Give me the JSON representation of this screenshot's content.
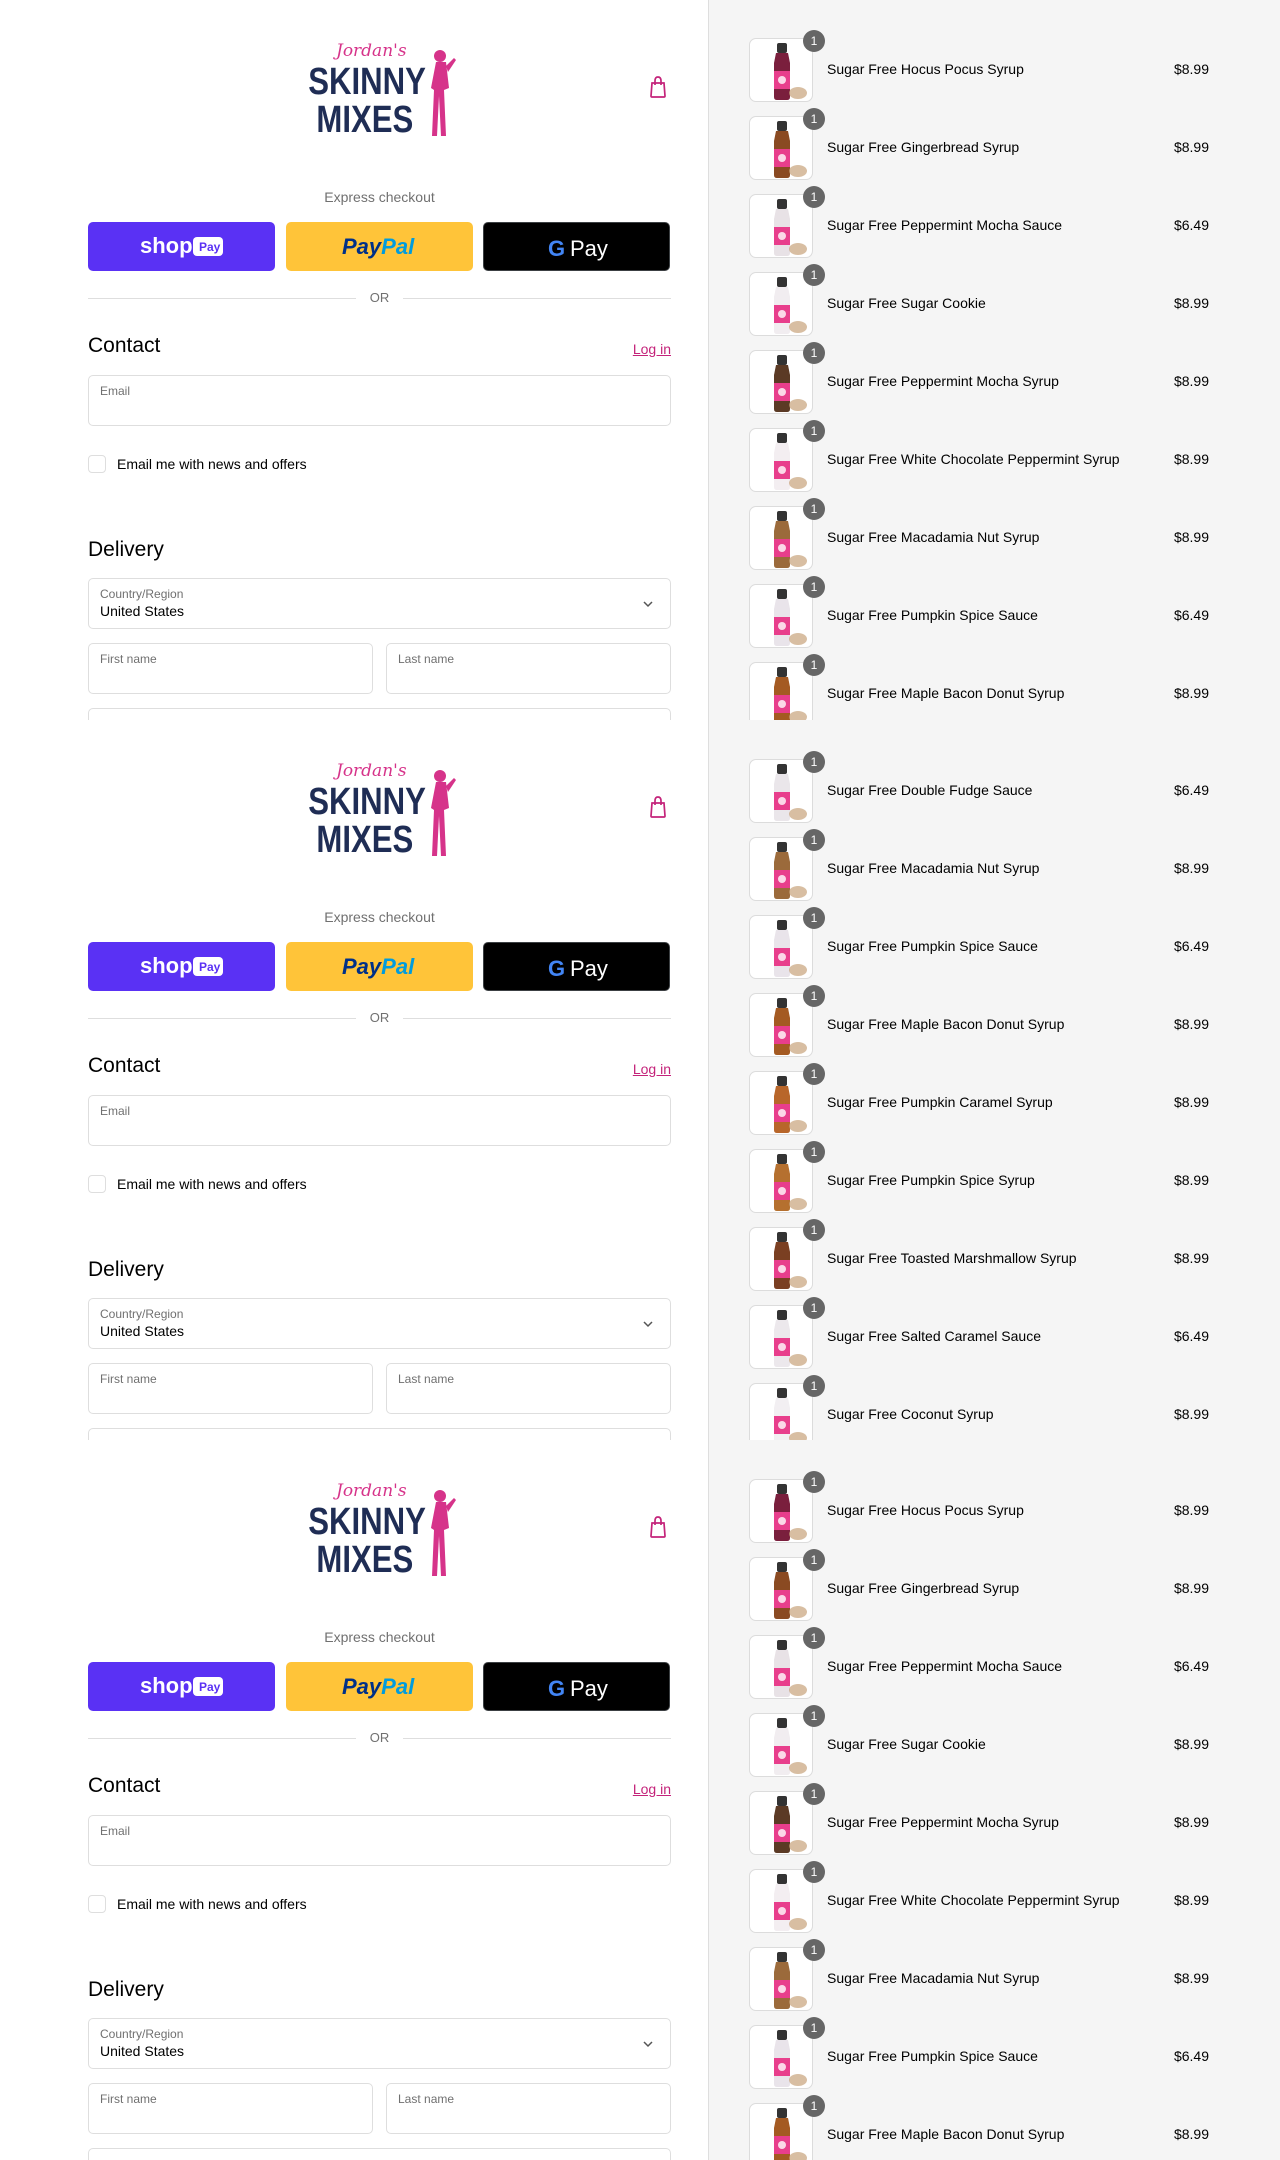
{
  "colors": {
    "accent": "#c4237a",
    "shop_pay": "#5a31f4",
    "paypal": "#ffc439",
    "gpay": "#000000",
    "summary_bg": "#f5f5f5"
  },
  "brand": {
    "logo_script": "Jordan's",
    "logo_line1": "SKINNY",
    "logo_line2": "MIXES"
  },
  "express": {
    "label": "Express checkout",
    "shop_pay": {
      "word": "shop",
      "badge": "Pay"
    },
    "paypal": {
      "pay": "Pay",
      "pal": "Pal"
    },
    "gpay": {
      "g": "G",
      "pay": "Pay"
    },
    "divider": "OR"
  },
  "contact": {
    "title": "Contact",
    "login": "Log in",
    "email_label": "Email",
    "newsletter": "Email me with news and offers"
  },
  "delivery": {
    "title": "Delivery",
    "country_label": "Country/Region",
    "country_value": "United States",
    "first_name": "First name",
    "last_name": "Last name"
  },
  "segments": [
    {
      "items": [
        {
          "name": "Sugar Free Hocus Pocus Syrup",
          "price": "$8.99",
          "qty": "1",
          "bottle": "#7a1f3d"
        },
        {
          "name": "Sugar Free Gingerbread Syrup",
          "price": "$8.99",
          "qty": "1",
          "bottle": "#8a4a22"
        },
        {
          "name": "Sugar Free Peppermint Mocha Sauce",
          "price": "$6.49",
          "qty": "1",
          "bottle": "#e8e2e6"
        },
        {
          "name": "Sugar Free Sugar Cookie",
          "price": "$8.99",
          "qty": "1",
          "bottle": "#f1edf0"
        },
        {
          "name": "Sugar Free Peppermint Mocha Syrup",
          "price": "$8.99",
          "qty": "1",
          "bottle": "#5b3a25"
        },
        {
          "name": "Sugar Free White Chocolate Peppermint Syrup",
          "price": "$8.99",
          "qty": "1",
          "bottle": "#f3eef1"
        },
        {
          "name": "Sugar Free Macadamia Nut Syrup",
          "price": "$8.99",
          "qty": "1",
          "bottle": "#9b6a3b"
        },
        {
          "name": "Sugar Free Pumpkin Spice Sauce",
          "price": "$6.49",
          "qty": "1",
          "bottle": "#e9e4ea"
        },
        {
          "name": "Sugar Free Maple Bacon Donut Syrup",
          "price": "$8.99",
          "qty": "1",
          "bottle": "#a45a22"
        }
      ]
    },
    {
      "items": [
        {
          "name": "Sugar Free Double Fudge Sauce",
          "price": "$6.49",
          "qty": "1",
          "bottle": "#eae6ea"
        },
        {
          "name": "Sugar Free Macadamia Nut Syrup",
          "price": "$8.99",
          "qty": "1",
          "bottle": "#9b6a3b"
        },
        {
          "name": "Sugar Free Pumpkin Spice Sauce",
          "price": "$6.49",
          "qty": "1",
          "bottle": "#e9e4ea"
        },
        {
          "name": "Sugar Free Maple Bacon Donut Syrup",
          "price": "$8.99",
          "qty": "1",
          "bottle": "#a45a22"
        },
        {
          "name": "Sugar Free Pumpkin Caramel Syrup",
          "price": "$8.99",
          "qty": "1",
          "bottle": "#b8662a"
        },
        {
          "name": "Sugar Free Pumpkin Spice Syrup",
          "price": "$8.99",
          "qty": "1",
          "bottle": "#b5702f"
        },
        {
          "name": "Sugar Free Toasted Marshmallow Syrup",
          "price": "$8.99",
          "qty": "1",
          "bottle": "#7a3f22"
        },
        {
          "name": "Sugar Free Salted Caramel Sauce",
          "price": "$6.49",
          "qty": "1",
          "bottle": "#ece8ec"
        },
        {
          "name": "Sugar Free Coconut Syrup",
          "price": "$8.99",
          "qty": "1",
          "bottle": "#f2eff2"
        }
      ]
    },
    {
      "items": [
        {
          "name": "Sugar Free Hocus Pocus Syrup",
          "price": "$8.99",
          "qty": "1",
          "bottle": "#7a1f3d"
        },
        {
          "name": "Sugar Free Gingerbread Syrup",
          "price": "$8.99",
          "qty": "1",
          "bottle": "#8a4a22"
        },
        {
          "name": "Sugar Free Peppermint Mocha Sauce",
          "price": "$6.49",
          "qty": "1",
          "bottle": "#e8e2e6"
        },
        {
          "name": "Sugar Free Sugar Cookie",
          "price": "$8.99",
          "qty": "1",
          "bottle": "#f1edf0"
        },
        {
          "name": "Sugar Free Peppermint Mocha Syrup",
          "price": "$8.99",
          "qty": "1",
          "bottle": "#5b3a25"
        },
        {
          "name": "Sugar Free White Chocolate Peppermint Syrup",
          "price": "$8.99",
          "qty": "1",
          "bottle": "#f3eef1"
        },
        {
          "name": "Sugar Free Macadamia Nut Syrup",
          "price": "$8.99",
          "qty": "1",
          "bottle": "#9b6a3b"
        },
        {
          "name": "Sugar Free Pumpkin Spice Sauce",
          "price": "$6.49",
          "qty": "1",
          "bottle": "#e9e4ea"
        },
        {
          "name": "Sugar Free Maple Bacon Donut Syrup",
          "price": "$8.99",
          "qty": "1",
          "bottle": "#a45a22"
        }
      ]
    }
  ]
}
